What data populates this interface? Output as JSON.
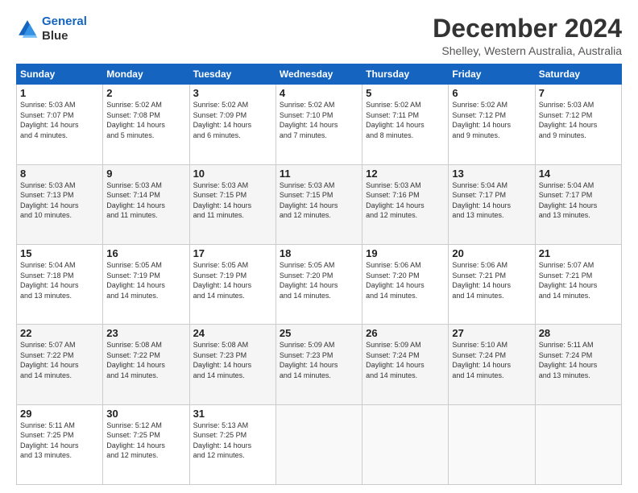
{
  "logo": {
    "line1": "General",
    "line2": "Blue"
  },
  "title": "December 2024",
  "subtitle": "Shelley, Western Australia, Australia",
  "days_header": [
    "Sunday",
    "Monday",
    "Tuesday",
    "Wednesday",
    "Thursday",
    "Friday",
    "Saturday"
  ],
  "weeks": [
    [
      {
        "day": "1",
        "info": "Sunrise: 5:03 AM\nSunset: 7:07 PM\nDaylight: 14 hours\nand 4 minutes."
      },
      {
        "day": "2",
        "info": "Sunrise: 5:02 AM\nSunset: 7:08 PM\nDaylight: 14 hours\nand 5 minutes."
      },
      {
        "day": "3",
        "info": "Sunrise: 5:02 AM\nSunset: 7:09 PM\nDaylight: 14 hours\nand 6 minutes."
      },
      {
        "day": "4",
        "info": "Sunrise: 5:02 AM\nSunset: 7:10 PM\nDaylight: 14 hours\nand 7 minutes."
      },
      {
        "day": "5",
        "info": "Sunrise: 5:02 AM\nSunset: 7:11 PM\nDaylight: 14 hours\nand 8 minutes."
      },
      {
        "day": "6",
        "info": "Sunrise: 5:02 AM\nSunset: 7:12 PM\nDaylight: 14 hours\nand 9 minutes."
      },
      {
        "day": "7",
        "info": "Sunrise: 5:03 AM\nSunset: 7:12 PM\nDaylight: 14 hours\nand 9 minutes."
      }
    ],
    [
      {
        "day": "8",
        "info": "Sunrise: 5:03 AM\nSunset: 7:13 PM\nDaylight: 14 hours\nand 10 minutes."
      },
      {
        "day": "9",
        "info": "Sunrise: 5:03 AM\nSunset: 7:14 PM\nDaylight: 14 hours\nand 11 minutes."
      },
      {
        "day": "10",
        "info": "Sunrise: 5:03 AM\nSunset: 7:15 PM\nDaylight: 14 hours\nand 11 minutes."
      },
      {
        "day": "11",
        "info": "Sunrise: 5:03 AM\nSunset: 7:15 PM\nDaylight: 14 hours\nand 12 minutes."
      },
      {
        "day": "12",
        "info": "Sunrise: 5:03 AM\nSunset: 7:16 PM\nDaylight: 14 hours\nand 12 minutes."
      },
      {
        "day": "13",
        "info": "Sunrise: 5:04 AM\nSunset: 7:17 PM\nDaylight: 14 hours\nand 13 minutes."
      },
      {
        "day": "14",
        "info": "Sunrise: 5:04 AM\nSunset: 7:17 PM\nDaylight: 14 hours\nand 13 minutes."
      }
    ],
    [
      {
        "day": "15",
        "info": "Sunrise: 5:04 AM\nSunset: 7:18 PM\nDaylight: 14 hours\nand 13 minutes."
      },
      {
        "day": "16",
        "info": "Sunrise: 5:05 AM\nSunset: 7:19 PM\nDaylight: 14 hours\nand 14 minutes."
      },
      {
        "day": "17",
        "info": "Sunrise: 5:05 AM\nSunset: 7:19 PM\nDaylight: 14 hours\nand 14 minutes."
      },
      {
        "day": "18",
        "info": "Sunrise: 5:05 AM\nSunset: 7:20 PM\nDaylight: 14 hours\nand 14 minutes."
      },
      {
        "day": "19",
        "info": "Sunrise: 5:06 AM\nSunset: 7:20 PM\nDaylight: 14 hours\nand 14 minutes."
      },
      {
        "day": "20",
        "info": "Sunrise: 5:06 AM\nSunset: 7:21 PM\nDaylight: 14 hours\nand 14 minutes."
      },
      {
        "day": "21",
        "info": "Sunrise: 5:07 AM\nSunset: 7:21 PM\nDaylight: 14 hours\nand 14 minutes."
      }
    ],
    [
      {
        "day": "22",
        "info": "Sunrise: 5:07 AM\nSunset: 7:22 PM\nDaylight: 14 hours\nand 14 minutes."
      },
      {
        "day": "23",
        "info": "Sunrise: 5:08 AM\nSunset: 7:22 PM\nDaylight: 14 hours\nand 14 minutes."
      },
      {
        "day": "24",
        "info": "Sunrise: 5:08 AM\nSunset: 7:23 PM\nDaylight: 14 hours\nand 14 minutes."
      },
      {
        "day": "25",
        "info": "Sunrise: 5:09 AM\nSunset: 7:23 PM\nDaylight: 14 hours\nand 14 minutes."
      },
      {
        "day": "26",
        "info": "Sunrise: 5:09 AM\nSunset: 7:24 PM\nDaylight: 14 hours\nand 14 minutes."
      },
      {
        "day": "27",
        "info": "Sunrise: 5:10 AM\nSunset: 7:24 PM\nDaylight: 14 hours\nand 14 minutes."
      },
      {
        "day": "28",
        "info": "Sunrise: 5:11 AM\nSunset: 7:24 PM\nDaylight: 14 hours\nand 13 minutes."
      }
    ],
    [
      {
        "day": "29",
        "info": "Sunrise: 5:11 AM\nSunset: 7:25 PM\nDaylight: 14 hours\nand 13 minutes."
      },
      {
        "day": "30",
        "info": "Sunrise: 5:12 AM\nSunset: 7:25 PM\nDaylight: 14 hours\nand 12 minutes."
      },
      {
        "day": "31",
        "info": "Sunrise: 5:13 AM\nSunset: 7:25 PM\nDaylight: 14 hours\nand 12 minutes."
      },
      {
        "day": "",
        "info": ""
      },
      {
        "day": "",
        "info": ""
      },
      {
        "day": "",
        "info": ""
      },
      {
        "day": "",
        "info": ""
      }
    ]
  ]
}
